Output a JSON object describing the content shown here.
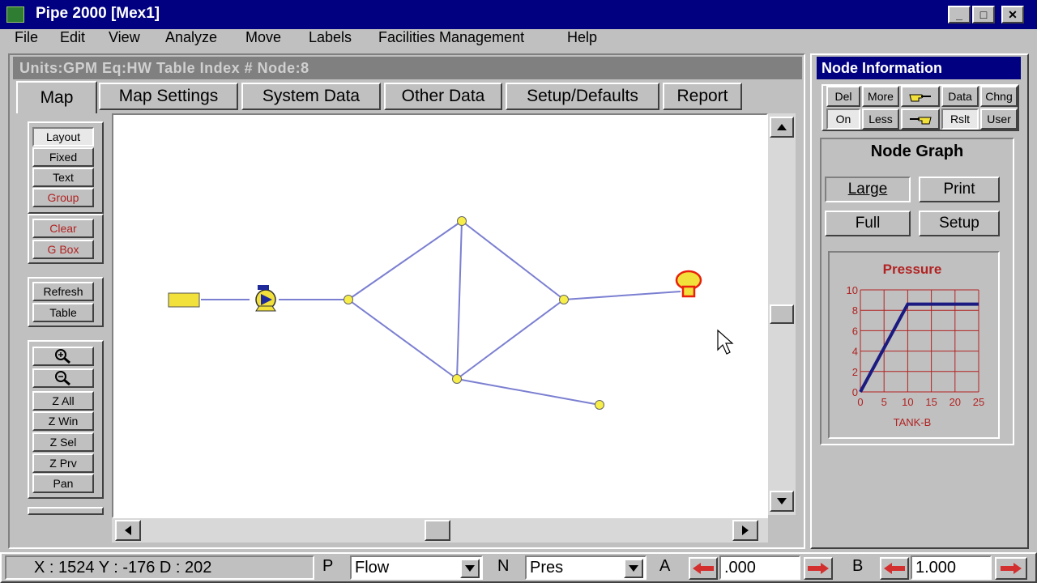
{
  "window": {
    "title": "Pipe 2000  [Mex1]",
    "min_label": "_",
    "max_label": "□",
    "close_label": "✕"
  },
  "menu": [
    "File",
    "Edit",
    "View",
    "Analyze",
    "Move",
    "Labels",
    "Facilities Management",
    "Help"
  ],
  "status_header": "Units:GPM  Eq:HW  Table Index #  Node:8",
  "tabs": [
    "Map",
    "Map Settings",
    "System Data",
    "Other Data",
    "Setup/Defaults",
    "Report"
  ],
  "tools": {
    "group1": [
      "Layout",
      "Fixed",
      "Text",
      "Group"
    ],
    "group2": [
      "Clear",
      "G Box"
    ],
    "group3": [
      "Refresh",
      "Table"
    ],
    "group4": [
      "Z All",
      "Z Win",
      "Z Sel",
      "Z Prv",
      "Pan"
    ]
  },
  "node_info": {
    "title": "Node Information",
    "row1": [
      "Del",
      "More",
      "Data",
      "Chng"
    ],
    "row2": [
      "On",
      "Less",
      "Rslt",
      "User"
    ]
  },
  "node_graph": {
    "title": "Node Graph",
    "buttons": [
      "Large",
      "Print",
      "Full",
      "Setup"
    ]
  },
  "chart_data": {
    "type": "line",
    "title": "Pressure",
    "xlabel": "TANK-B",
    "ylabel": "",
    "x": [
      0,
      10,
      25
    ],
    "y": [
      0,
      8.6,
      8.6
    ],
    "xticks": [
      0,
      5,
      10,
      15,
      20,
      25
    ],
    "yticks": [
      0,
      2,
      4,
      6,
      8,
      10
    ],
    "xlim": [
      0,
      25
    ],
    "ylim": [
      0,
      10
    ],
    "grid": true,
    "color": "#1a1a80"
  },
  "statusbar": {
    "coords": "X : 1524  Y : -176   D : 202",
    "p_label": "P",
    "p_value": "Flow",
    "n_label": "N",
    "n_value": "Pres",
    "a_label": "A",
    "a_value": ".000",
    "b_label": "B",
    "b_value": "1.000"
  },
  "colors": {
    "titlebar": "#000080",
    "pipe": "#7b7fd1",
    "node": "#f7ee4a",
    "tank": "#f2e03b",
    "accent_red": "#b22222"
  }
}
